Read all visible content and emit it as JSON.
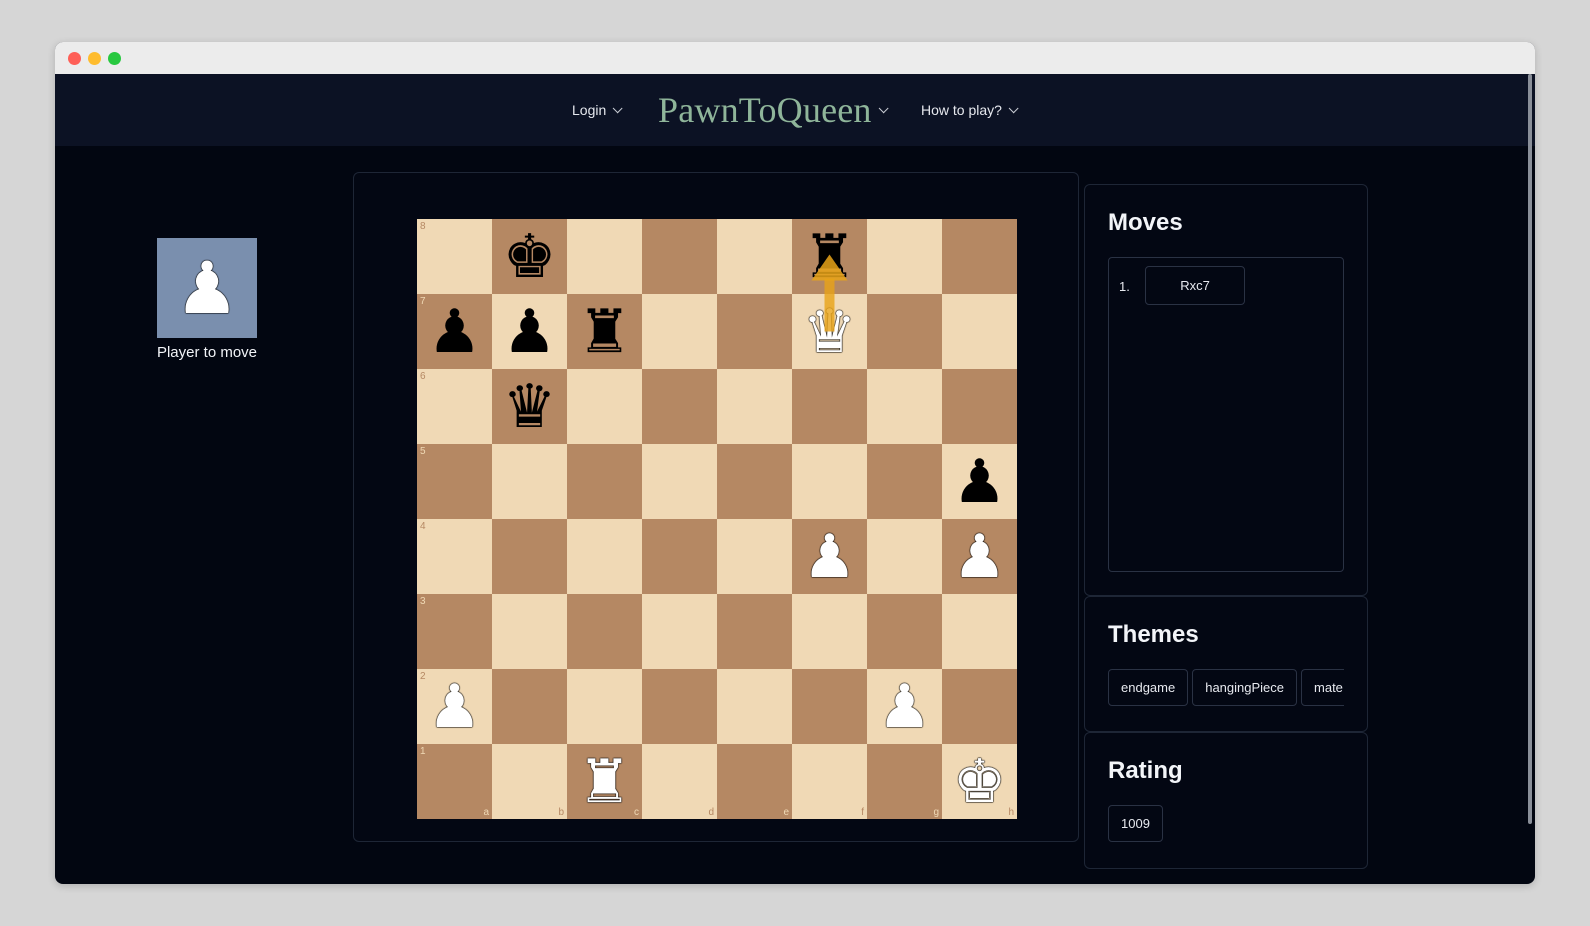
{
  "nav": {
    "login_label": "Login",
    "brand": "PawnToQueen",
    "howto_label": "How to play?"
  },
  "player": {
    "label": "Player to move",
    "avatar_piece": "♟"
  },
  "board": {
    "ranks": [
      "8",
      "7",
      "6",
      "5",
      "4",
      "3",
      "2",
      "1"
    ],
    "files": [
      "a",
      "b",
      "c",
      "d",
      "e",
      "f",
      "g",
      "h"
    ],
    "pieces": {
      "b8": {
        "glyph": "♚",
        "color": "b"
      },
      "f8": {
        "glyph": "♜",
        "color": "b"
      },
      "a7": {
        "glyph": "♟",
        "color": "b"
      },
      "b7": {
        "glyph": "♟",
        "color": "b"
      },
      "c7": {
        "glyph": "♜",
        "color": "b"
      },
      "f7": {
        "glyph": "♛",
        "color": "w"
      },
      "b6": {
        "glyph": "♛",
        "color": "b"
      },
      "h5": {
        "glyph": "♟",
        "color": "b"
      },
      "f4": {
        "glyph": "♟",
        "color": "w"
      },
      "h4": {
        "glyph": "♟",
        "color": "w"
      },
      "a2": {
        "glyph": "♟",
        "color": "w"
      },
      "g2": {
        "glyph": "♟",
        "color": "w"
      },
      "c1": {
        "glyph": "♜",
        "color": "w"
      },
      "h1": {
        "glyph": "♚",
        "color": "w"
      }
    },
    "hint_arrow": {
      "from": "f7",
      "to": "f8",
      "color": "#e8a317"
    },
    "light_color": "#f0d9b5",
    "dark_color": "#b58863"
  },
  "moves": {
    "title": "Moves",
    "items": [
      {
        "num": "1.",
        "san": "Rxc7"
      }
    ]
  },
  "themes": {
    "title": "Themes",
    "tags": [
      "endgame",
      "hangingPiece",
      "mate"
    ]
  },
  "rating": {
    "title": "Rating",
    "value": "1009"
  }
}
